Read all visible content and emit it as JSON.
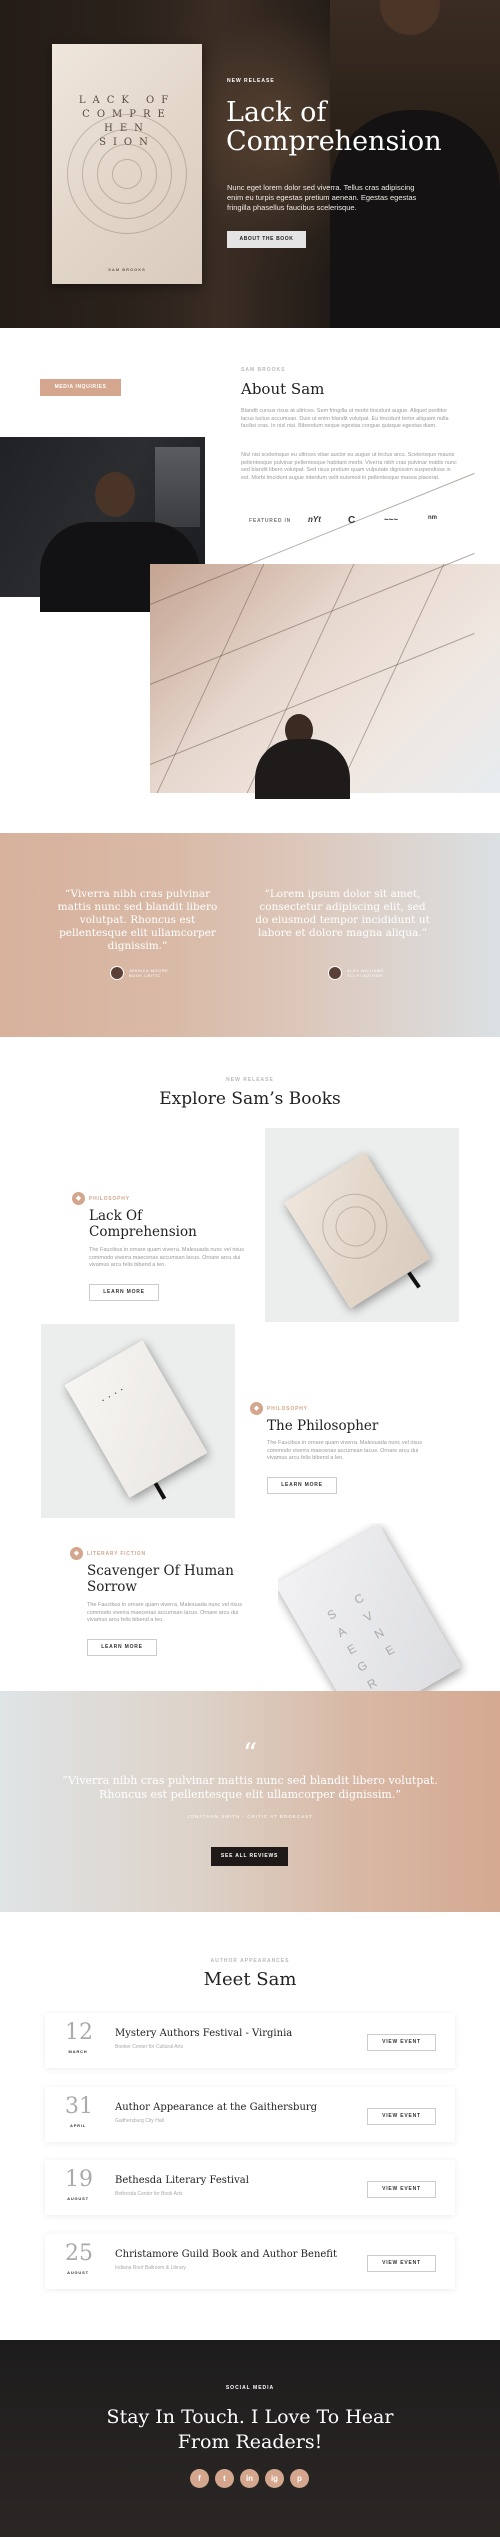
{
  "hero": {
    "book": {
      "title": "LACK OF COMPRE HEN SION",
      "author": "SAM BROOKS"
    },
    "eyebrow": "NEW RELEASE",
    "title": "Lack of Comprehension",
    "description": "Nunc eget lorem dolor sed viverra. Tellus cras adipiscing enim eu turpis egestas pretium aenean. Egestas egestas fringilla phasellus faucibus scelerisque.",
    "button": "ABOUT THE BOOK"
  },
  "about": {
    "badge": "MEDIA INQUIRIES",
    "eyebrow": "SAM BROOKS",
    "title": "About Sam",
    "p1": "Blandit cursus risus at ultrices. Sem fringilla ut morbi tincidunt augue. Aliquet porttitor lacus luctus accumsan. Duis ut enim blandit volutpat. Eu tincidunt tortor aliquam nulla facilisi cras. In nisl nisi. Bibendum neque egestas congue quisque egestas diam.",
    "p2": "Nisl nisi scelerisque eu ultrices vitae auctor eu augue ut lectus arcu. Scelerisque mauris pellentesque pulvinar pellentesque habitant morbi. Viverra nibh cras pulvinar mattis nunc sed blandit libero volutpat. Sed risus pretium quam vulputate dignissim suspendisse in est. Morbi tincidunt augue interdum velit euismod in pellentesque massa placerat.",
    "featured_label": "FEATURED IN",
    "logos": [
      "nYt",
      "C",
      "~~~",
      "nm"
    ]
  },
  "quotes": [
    {
      "text": "“Viverra nibh cras pulvinar mattis nunc sed blandit libero volutpat. Rhoncus est pellentesque elit ullamcorper dignissim.”",
      "name": "JESSICA MOORE",
      "role": "BOOK CRITIC"
    },
    {
      "text": "“Lorem ipsum dolor sit amet, consectetur adipiscing elit, sed do eiusmod tempor incididunt ut labore et dolore magna aliqua.”",
      "name": "ALEX WILLIAMS",
      "role": "SCI-FI AUTHOR"
    }
  ],
  "books": {
    "eyebrow": "NEW RELEASE",
    "title": "Explore Sam’s Books",
    "items": [
      {
        "category": "PHILOSOPHY",
        "title": "Lack Of Comprehension",
        "description": "The Faucibus in ornare quam viverra. Malesuada nunc vel risus commodo viverra maecenas accumsan lacus. Ornare arcu dui vivamus arcu felis bibend a leo.",
        "button": "LEARN MORE"
      },
      {
        "category": "PHILOSOPHY",
        "title": "The Philosopher",
        "description": "The Faucibus in ornare quam viverra. Malesuada nunc vel risus commodo viverra maecenas accumsan lacus. Ornare arcu dui vivamus arcu felis bibend a leo.",
        "button": "LEARN MORE"
      },
      {
        "category": "LITERARY FICTION",
        "title": "Scavenger Of Human Sorrow",
        "description": "The Faucibus in ornare quam viverra. Malesuada nunc vel risus commodo viverra maecenas accumsan lacus. Ornare arcu dui vivamus arcu felis bibend a leo.",
        "button": "LEARN MORE"
      }
    ]
  },
  "review": {
    "quote_mark": "“",
    "text": "“Viverra nibh cras pulvinar mattis nunc sed blandit libero volutpat. Rhoncus est pellentesque elit ullamcorper dignissim.”",
    "by": "JONATHAN SMITH - CRITIC AT BOOKCAST",
    "button": "SEE ALL REVIEWS"
  },
  "events": {
    "eyebrow": "AUTHOR APPEARANCES",
    "title": "Meet Sam",
    "items": [
      {
        "day": "12",
        "month": "MARCH",
        "title": "Mystery Authors Festival - Virginia",
        "location": "Booker Center for Cultural Arts",
        "button": "VIEW EVENT"
      },
      {
        "day": "31",
        "month": "APRIL",
        "title": "Author Appearance at the Gaithersburg",
        "location": "Gaithersburg City Hall",
        "button": "VIEW EVENT"
      },
      {
        "day": "19",
        "month": "AUGUST",
        "title": "Bethesda Literary Festival",
        "location": "Bethesda Center for Book Arts",
        "button": "VIEW EVENT"
      },
      {
        "day": "25",
        "month": "AUGUST",
        "title": "Christamore Guild Book and Author Benefit",
        "location": "Indiana Roof Ballroom & Library",
        "button": "VIEW EVENT"
      }
    ]
  },
  "footer": {
    "eyebrow": "SOCIAL MEDIA",
    "title": "Stay In Touch. I Love To Hear From Readers!",
    "social": [
      "f",
      "t",
      "in",
      "ig",
      "p"
    ]
  },
  "colors": {
    "accent": "#d3a68d",
    "dark": "#1f1a18"
  }
}
